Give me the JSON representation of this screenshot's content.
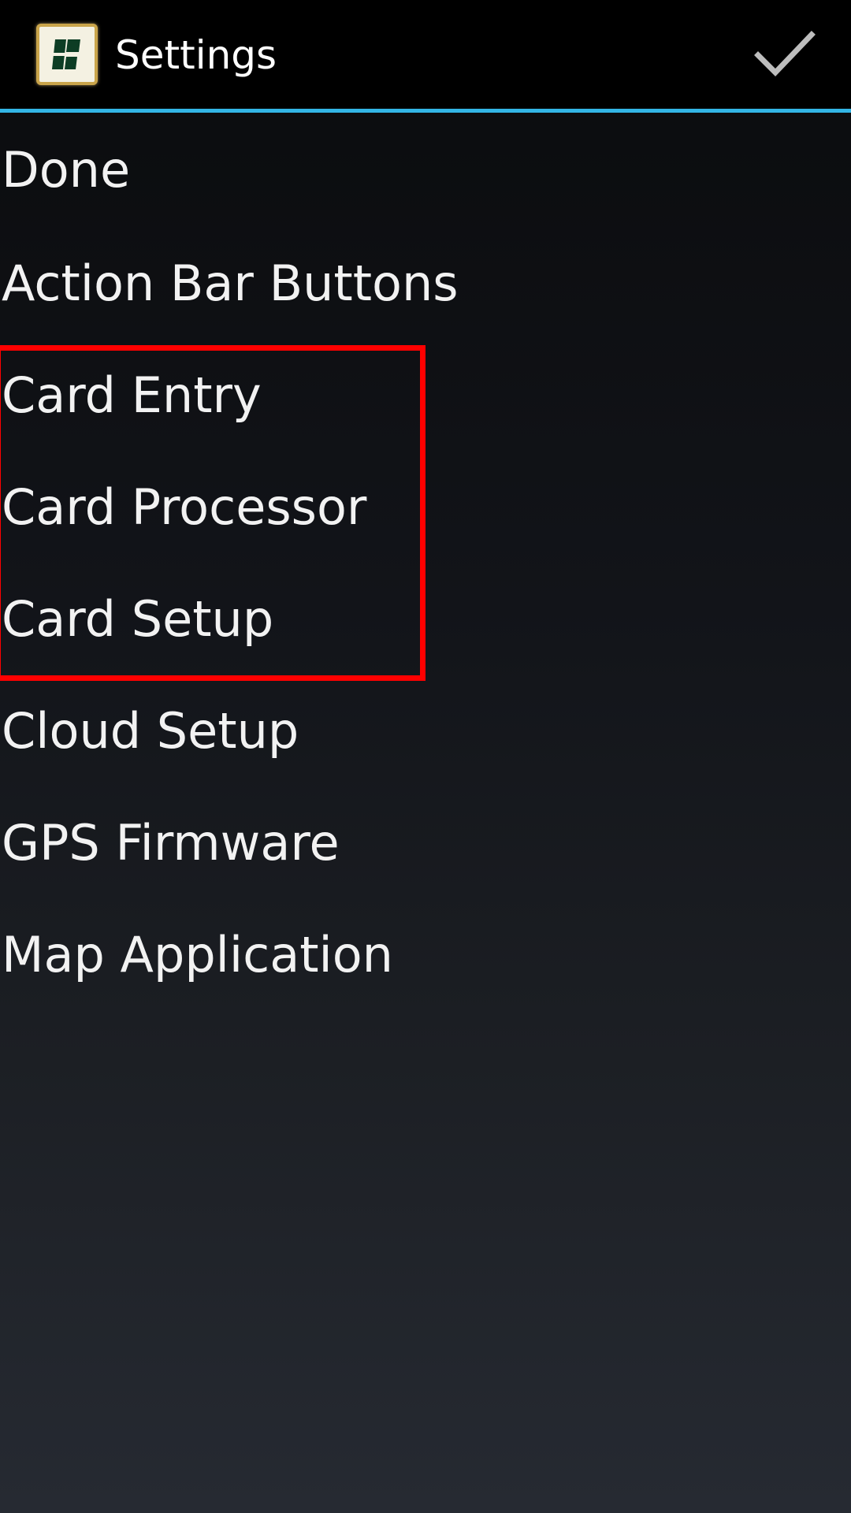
{
  "action_bar": {
    "title": "Settings",
    "app_icon": "app-logo-icon",
    "action_icon": "checkmark-icon",
    "divider_color": "#33b5e5"
  },
  "menu": {
    "items": [
      {
        "label": "Done"
      },
      {
        "label": "Action Bar Buttons"
      },
      {
        "label": "Card Entry"
      },
      {
        "label": "Card Processor"
      },
      {
        "label": "Card Setup"
      },
      {
        "label": "Cloud Setup"
      },
      {
        "label": "GPS Firmware"
      },
      {
        "label": "Map Application"
      }
    ]
  },
  "highlight": {
    "color": "#ff0000",
    "covers": [
      "Card Entry",
      "Card Processor",
      "Card Setup"
    ]
  }
}
